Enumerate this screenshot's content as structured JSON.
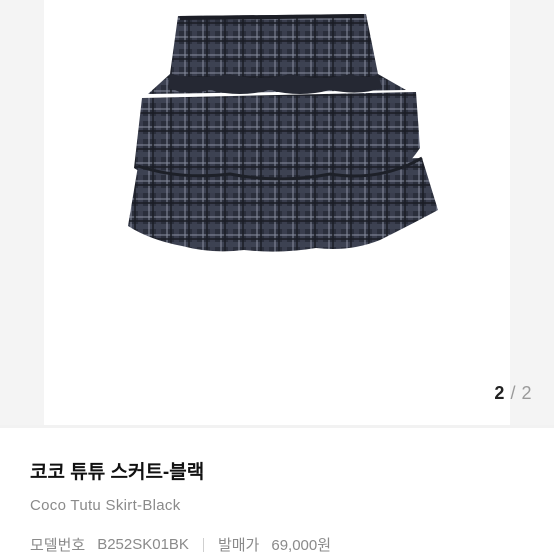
{
  "product": {
    "image_alt": "plaid tiered mini skirt",
    "title_ko": "코코 튜튜 스커트-블랙",
    "title_en": "Coco Tutu Skirt-Black",
    "model_label": "모델번호",
    "model_value": "B252SK01BK",
    "price_label": "발매가",
    "price_value": "69,000원"
  },
  "pager": {
    "current": "2",
    "separator": "/",
    "total": "2"
  },
  "colors": {
    "plaid_dark": "#2b2f3c",
    "plaid_line": "#8a8fa0",
    "muted_text": "#8a8a8a"
  }
}
